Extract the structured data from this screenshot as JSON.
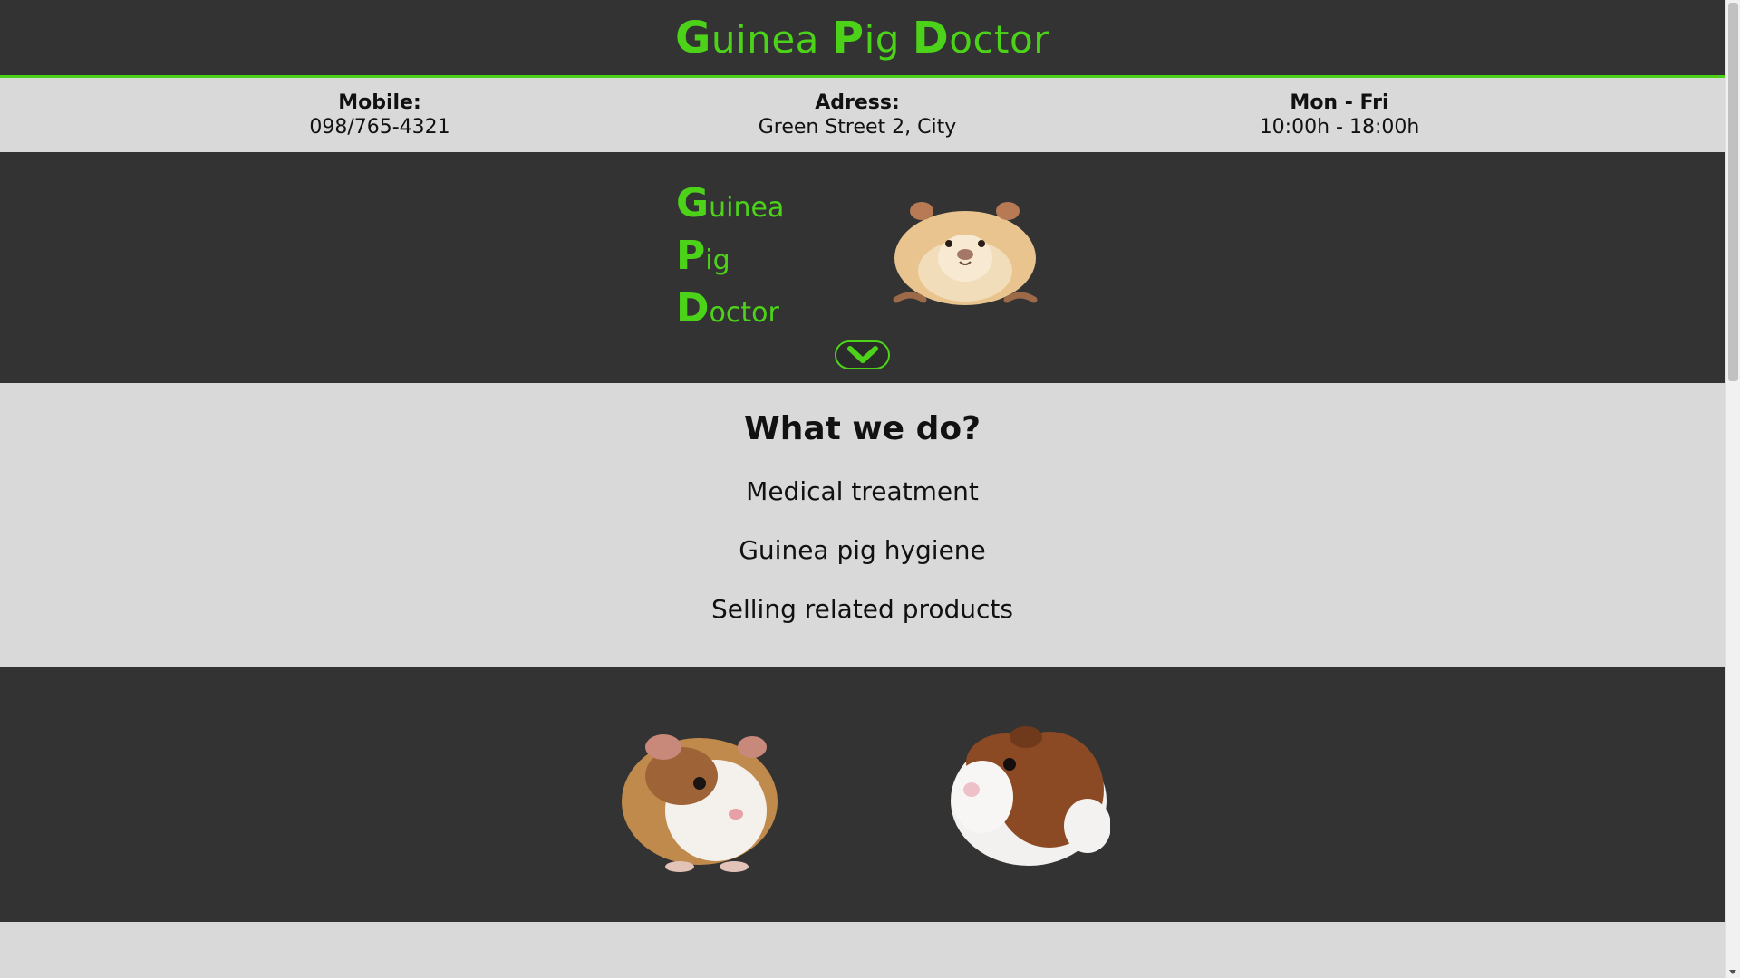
{
  "header": {
    "title_words": [
      {
        "cap": "G",
        "rest": "uinea"
      },
      {
        "cap": "P",
        "rest": "ig"
      },
      {
        "cap": "D",
        "rest": "octor"
      }
    ]
  },
  "info": {
    "mobile": {
      "label": "Mobile:",
      "value": "098/765-4321"
    },
    "address": {
      "label": "Adress:",
      "value": "Green Street 2, City"
    },
    "hours": {
      "label": "Mon - Fri",
      "value": "10:00h - 18:00h"
    }
  },
  "hero": {
    "lines": [
      {
        "cap": "G",
        "rest": "uinea"
      },
      {
        "cap": "P",
        "rest": "ig"
      },
      {
        "cap": "D",
        "rest": "octor"
      }
    ]
  },
  "services": {
    "heading": "What we do?",
    "items": [
      "Medical treatment",
      "Guinea pig hygiene",
      "Selling related products"
    ]
  },
  "colors": {
    "accent": "#4cd219",
    "dark": "#333333",
    "light": "#d9d9d9"
  }
}
